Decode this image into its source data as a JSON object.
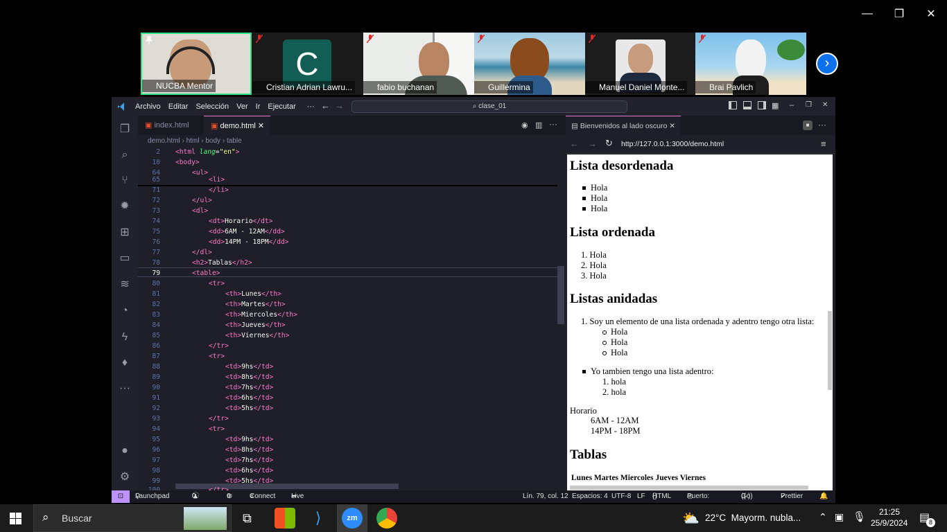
{
  "participants": [
    {
      "name": "NUCBA Mentor",
      "muted": false,
      "pinned": true
    },
    {
      "name": "Cristian Adrian Lawru...",
      "initial": "C",
      "muted": true
    },
    {
      "name": "fabio buchanan",
      "muted": true
    },
    {
      "name": "Guillermina",
      "muted": true
    },
    {
      "name": "Manuel Daniel Monte...",
      "muted": true
    },
    {
      "name": "Brai Pavlich",
      "muted": true
    }
  ],
  "zoom": {
    "next_icon": "chevron-right-icon",
    "window_controls": [
      "minimize",
      "restore",
      "close"
    ]
  },
  "vscode": {
    "menu": [
      "Archivo",
      "Editar",
      "Selección",
      "Ver",
      "Ir",
      "Ejecutar",
      "···"
    ],
    "search": "clase_01",
    "tabs": [
      {
        "label": "index.html",
        "active": false
      },
      {
        "label": "demo.html",
        "active": true
      }
    ],
    "breadcrumb": [
      "demo.html",
      "html",
      "body",
      "table"
    ],
    "line_numbers": [
      "2",
      "10",
      "64",
      "65",
      "71",
      "72",
      "73",
      "74",
      "75",
      "76",
      "77",
      "78",
      "79",
      "80",
      "81",
      "82",
      "83",
      "84",
      "85",
      "86",
      "87",
      "88",
      "89",
      "90",
      "91",
      "92",
      "93",
      "94",
      "95",
      "96",
      "97",
      "98",
      "99",
      "100"
    ],
    "active_line": "79",
    "preview": {
      "tab_title": "Bienvenidos al lado oscuro",
      "url": "http://127.0.0.1:3000/demo.html",
      "h_desordenada": "Lista desordenada",
      "ul_items": [
        "Hola",
        "Hola",
        "Hola"
      ],
      "h_ordenada": "Lista ordenada",
      "ol_items": [
        "1. Hola",
        "2. Hola",
        "3. Hola"
      ],
      "h_anidadas": "Listas anidadas",
      "nested_1": "1. Soy un elemento de una lista ordenada y adentro tengo otra lista:",
      "nested_1_items": [
        "Hola",
        "Hola",
        "Hola"
      ],
      "nested_2": "Yo tambien tengo una lista adentro:",
      "nested_2_items": [
        "1. hola",
        "2. hola"
      ],
      "dt": "Horario",
      "dd": [
        "6AM - 12AM",
        "14PM - 18PM"
      ],
      "h_tablas": "Tablas",
      "table_header": "Lunes Martes Miercoles Jueves Viernes"
    },
    "status": {
      "launchpad": "Launchpad",
      "problems": "0",
      "warnings": "0",
      "ports": "0",
      "connect": "Connect",
      "liveshare": "Live Share",
      "position": "Lín. 79, col. 12",
      "spaces": "Espacios: 4",
      "encoding": "UTF-8",
      "eol": "LF",
      "language": "HTML",
      "port": "Puerto: 3000",
      "golive": "Go Live",
      "prettier": "Prettier"
    }
  },
  "taskbar": {
    "search": "Buscar",
    "weather": "22°C  Mayorm. nubla...",
    "time": "21:25",
    "date": "25/9/2024",
    "notifications": "8"
  },
  "colors": {
    "accent": "#bd93f9",
    "zoom_blue": "#0e71eb",
    "tag": "#ff79c6",
    "attr": "#50fa7b",
    "string": "#f1fa8c"
  }
}
